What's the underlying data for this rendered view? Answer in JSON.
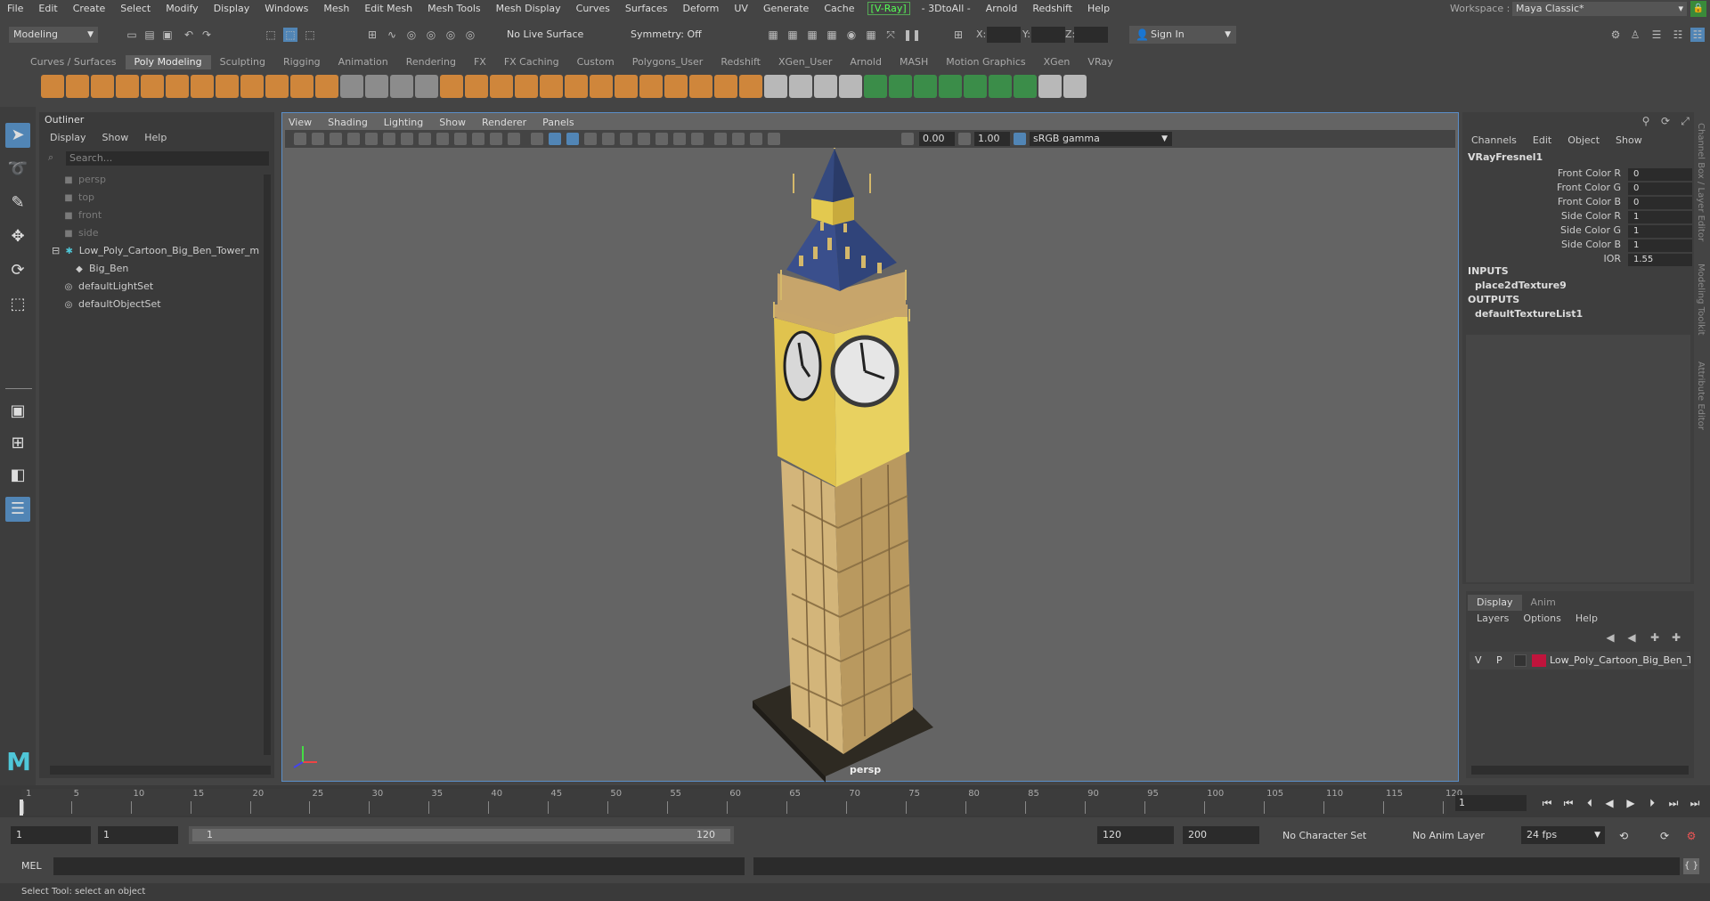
{
  "menubar": {
    "items": [
      "File",
      "Edit",
      "Create",
      "Select",
      "Modify",
      "Display",
      "Windows",
      "Mesh",
      "Edit Mesh",
      "Mesh Tools",
      "Mesh Display",
      "Curves",
      "Surfaces",
      "Deform",
      "UV",
      "Generate",
      "Cache"
    ],
    "vray_label": "[V-Ray]",
    "items_after": [
      "- 3DtoAll -",
      "Arnold",
      "Redshift",
      "Help"
    ],
    "workspace_label": "Workspace :",
    "workspace_value": "Maya Classic*"
  },
  "statusline": {
    "mode": "Modeling",
    "live_surface": "No Live Surface",
    "symmetry": "Symmetry: Off",
    "x_label": "X:",
    "y_label": "Y:",
    "z_label": "Z:",
    "sign_in": "Sign In"
  },
  "shelf": {
    "tabs": [
      "Curves / Surfaces",
      "Poly Modeling",
      "Sculpting",
      "Rigging",
      "Animation",
      "Rendering",
      "FX",
      "FX Caching",
      "Custom",
      "Polygons_User",
      "Redshift",
      "XGen_User",
      "Arnold",
      "MASH",
      "Motion Graphics",
      "XGen",
      "VRay"
    ],
    "active_tab": "Poly Modeling"
  },
  "outliner": {
    "title": "Outliner",
    "menu": [
      "Display",
      "Show",
      "Help"
    ],
    "search_placeholder": "Search...",
    "items": [
      {
        "label": "persp",
        "icon": "camera-icon",
        "dim": true,
        "indent": 1
      },
      {
        "label": "top",
        "icon": "camera-icon",
        "dim": true,
        "indent": 1
      },
      {
        "label": "front",
        "icon": "camera-icon",
        "dim": true,
        "indent": 1
      },
      {
        "label": "side",
        "icon": "camera-icon",
        "dim": true,
        "indent": 1
      },
      {
        "label": "Low_Poly_Cartoon_Big_Ben_Tower_m",
        "icon": "group-icon",
        "dim": false,
        "indent": 0
      },
      {
        "label": "Big_Ben",
        "icon": "mesh-icon",
        "dim": false,
        "indent": 2
      },
      {
        "label": "defaultLightSet",
        "icon": "set-icon",
        "dim": false,
        "indent": 1
      },
      {
        "label": "defaultObjectSet",
        "icon": "set-icon",
        "dim": false,
        "indent": 1
      }
    ]
  },
  "viewport": {
    "menu": [
      "View",
      "Shading",
      "Lighting",
      "Show",
      "Renderer",
      "Panels"
    ],
    "value1": "0.00",
    "value2": "1.00",
    "color_management": "sRGB gamma",
    "camera_label": "persp"
  },
  "channel_box": {
    "menu": [
      "Channels",
      "Edit",
      "Object",
      "Show"
    ],
    "node_name": "VRayFresnel1",
    "attributes": [
      {
        "label": "Front Color R",
        "value": "0"
      },
      {
        "label": "Front Color G",
        "value": "0"
      },
      {
        "label": "Front Color B",
        "value": "0"
      },
      {
        "label": "Side Color R",
        "value": "1"
      },
      {
        "label": "Side Color G",
        "value": "1"
      },
      {
        "label": "Side Color B",
        "value": "1"
      },
      {
        "label": "IOR",
        "value": "1.55"
      }
    ],
    "inputs_label": "INPUTS",
    "inputs_value": "place2dTexture9",
    "outputs_label": "OUTPUTS",
    "outputs_value": "defaultTextureList1",
    "side_tabs": [
      "Channel Box / Layer Editor",
      "Modeling Toolkit",
      "Attribute Editor"
    ]
  },
  "layer_editor": {
    "tabs": [
      "Display",
      "Anim"
    ],
    "active_tab": "Display",
    "menu": [
      "Layers",
      "Options",
      "Help"
    ],
    "layer": {
      "v": "V",
      "p": "P",
      "name": "Low_Poly_Cartoon_Big_Ben_To",
      "color": "#c0143c"
    }
  },
  "timeslider": {
    "tick_labels": [
      "1",
      "5",
      "10",
      "15",
      "20",
      "25",
      "30",
      "35",
      "40",
      "45",
      "50",
      "55",
      "60",
      "65",
      "70",
      "75",
      "80",
      "85",
      "90",
      "95",
      "100",
      "105",
      "110",
      "115",
      "120"
    ],
    "current_frame": "1"
  },
  "rangebar": {
    "start_field": "1",
    "start_field2": "1",
    "range_start": "1",
    "range_end": "120",
    "end_field": "120",
    "end_field2": "200",
    "character_set": "No Character Set",
    "anim_layer": "No Anim Layer",
    "fps": "24 fps"
  },
  "cmdline": {
    "label": "MEL"
  },
  "helpline": {
    "text": "Select Tool: select an object"
  },
  "colors": {
    "accent": "#5185b5",
    "tower_blue": "#3a4f8c",
    "tower_gold": "#d9c14a",
    "tower_tan": "#c8a86a"
  }
}
